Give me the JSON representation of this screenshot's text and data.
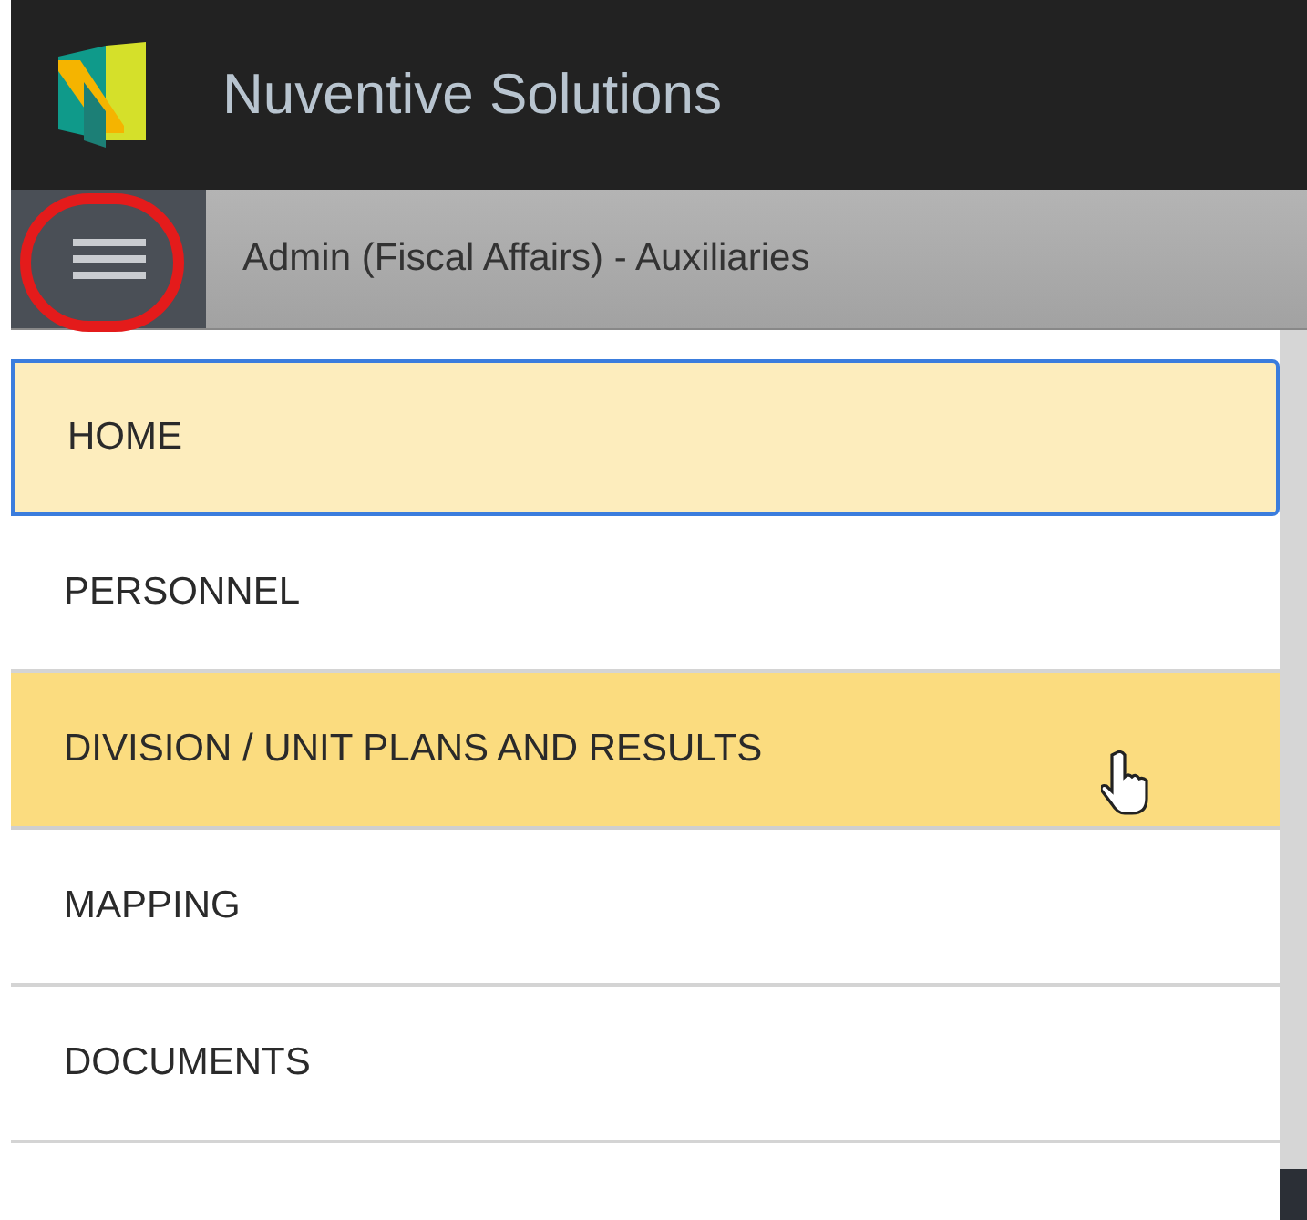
{
  "header": {
    "title": "Nuventive Solutions"
  },
  "subheader": {
    "unit": "Admin (Fiscal Affairs) - Auxiliaries"
  },
  "menu": [
    {
      "label": "HOME",
      "focused": true,
      "hovered": false
    },
    {
      "label": "PERSONNEL",
      "focused": false,
      "hovered": false
    },
    {
      "label": "DIVISION / UNIT PLANS AND RESULTS",
      "focused": false,
      "hovered": true
    },
    {
      "label": "MAPPING",
      "focused": false,
      "hovered": false
    },
    {
      "label": "DOCUMENTS",
      "focused": false,
      "hovered": false
    }
  ]
}
